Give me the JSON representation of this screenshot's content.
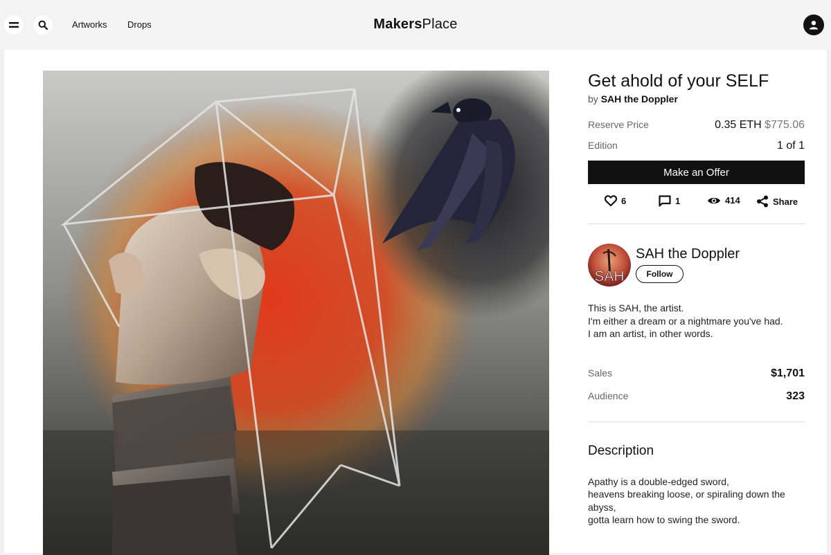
{
  "nav": {
    "links": [
      "Artworks",
      "Drops"
    ],
    "brand_bold": "Makers",
    "brand_regular": "Place"
  },
  "artwork": {
    "title": "Get ahold of your SELF",
    "by_prefix": "by",
    "artist": "SAH the Doppler"
  },
  "pricing": {
    "reserve_label": "Reserve Price",
    "reserve_eth": "0.35 ETH",
    "reserve_usd": "$775.06",
    "edition_label": "Edition",
    "edition_value": "1 of 1",
    "offer_label": "Make an Offer"
  },
  "stats": {
    "likes": "6",
    "comments": "1",
    "views": "414",
    "share_label": "Share"
  },
  "artist": {
    "name": "SAH the Doppler",
    "avatar_text": "SAH",
    "follow_label": "Follow",
    "bio": [
      "This is SAH, the artist.",
      "I'm either a dream or a nightmare you've had.",
      "I am an artist, in other words."
    ],
    "sales_label": "Sales",
    "sales_value": "$1,701",
    "audience_label": "Audience",
    "audience_value": "323"
  },
  "description": {
    "heading": "Description",
    "lines": [
      "Apathy is a double-edged sword,",
      "heavens breaking loose, or spiraling down the",
      "abyss,",
      "gotta learn how to swing the sword."
    ]
  },
  "colors": {
    "accent": "#111111",
    "page_bg": "#f1f1f1",
    "card_bg": "#ffffff"
  }
}
